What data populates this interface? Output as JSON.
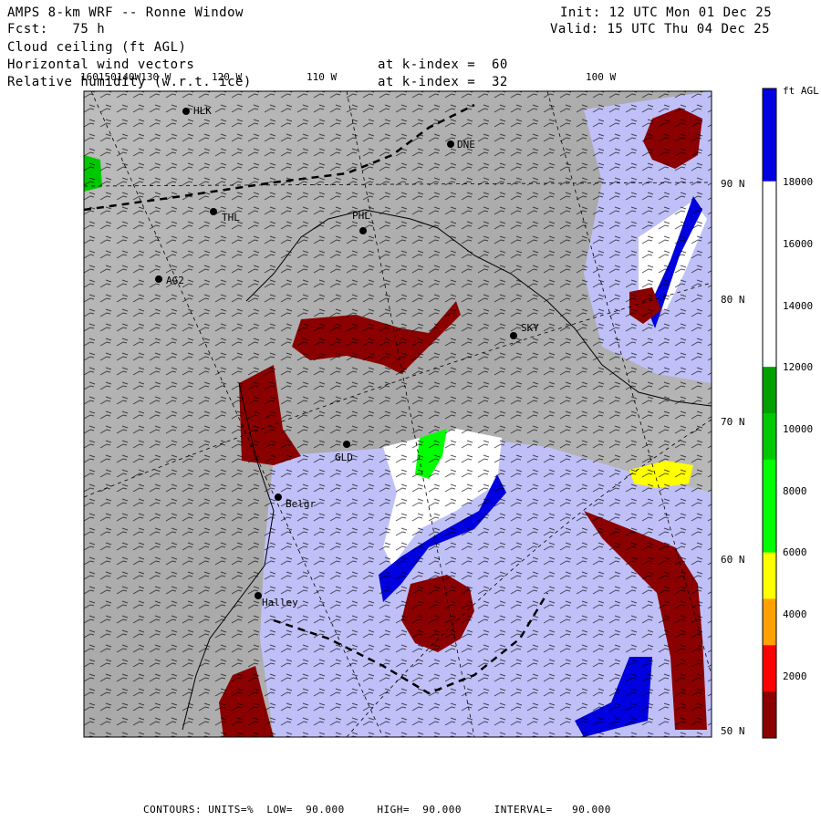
{
  "header": {
    "title": "AMPS 8-km WRF -- Ronne Window",
    "forecast": "Fcst:   75 h",
    "init": "Init: 12 UTC Mon 01 Dec 25",
    "valid": "Valid: 15 UTC Thu 04 Dec 25",
    "field1": "Cloud ceiling (ft AGL)",
    "field2": "Horizontal wind vectors",
    "field2_level": "at k-index =  60",
    "field3": "Relative humidity (w.r.t. ice)",
    "field3_level": "at k-index =  32"
  },
  "colorbar": {
    "unit": "ft AGL",
    "labels": [
      "18000",
      "16000",
      "14000",
      "12000",
      "10000",
      "8000",
      "6000",
      "4000",
      "2000"
    ],
    "colors": [
      "#0000e0",
      "#0000e0",
      "#ffffff",
      "#ffffff",
      "#ffffff",
      "#ffffff",
      "#00a000",
      "#00c800",
      "#00ff00",
      "#00ff00",
      "#ffff00",
      "#ffa000",
      "#ff0000",
      "#8b0000"
    ]
  },
  "lat_labels": [
    "90 N",
    "80 N",
    "70 N",
    "60 N",
    "50 N"
  ],
  "lon_labels": [
    "160150140W130 W",
    "120 W",
    "110 W",
    "100 W"
  ],
  "stations": [
    "HLK",
    "DNE",
    "THL",
    "PHL",
    "AG2",
    "SKY",
    "GLD",
    "Belgr",
    "Halley"
  ],
  "footer": "CONTOURS: UNITS=%  LOW=  90.000     HIGH=  90.000     INTERVAL=   90.000",
  "colors": {
    "ocean": "#c0c0f8",
    "land_gray": "#b4b4b4",
    "cloud_low": "#8b0000",
    "cloud_blue": "#0000e0"
  }
}
